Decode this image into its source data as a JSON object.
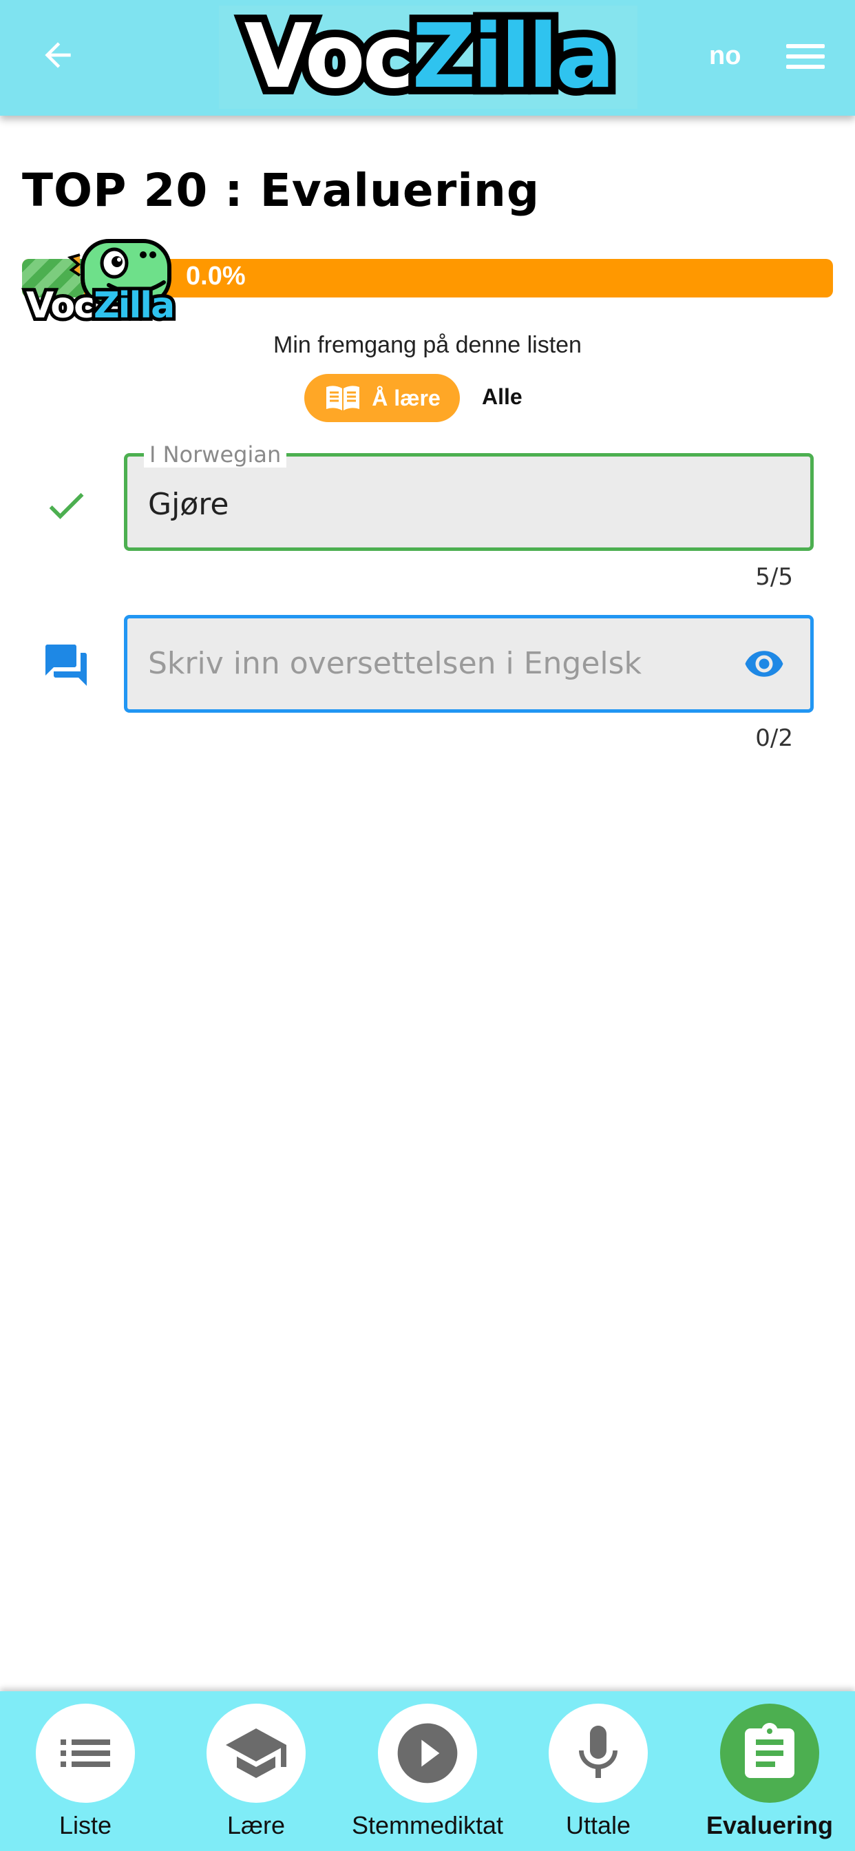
{
  "header": {
    "logo_part1": "Voc",
    "logo_part2": "Zilla",
    "language": "no",
    "back_icon": "arrow-left-icon",
    "menu_icon": "hamburger-menu-icon"
  },
  "page": {
    "title": "TOP 20 : Evaluering"
  },
  "progress": {
    "percent": 0.0,
    "text": "0.0%",
    "logo_part1": "Voc",
    "logo_part2": "Zilla",
    "caption": "Min fremgang på denne listen"
  },
  "toggle": {
    "learn_label": "Å lære",
    "all_label": "Alle",
    "learn_icon": "open-book-icon"
  },
  "norwegian_field": {
    "label": "I Norwegian",
    "value": "Gjøre",
    "counter": "5/5",
    "status_icon": "check-icon"
  },
  "english_field": {
    "placeholder": "Skriv inn oversettelsen i Engelsk",
    "value": "",
    "counter": "0/2",
    "icon": "chat-icon",
    "reveal_icon": "eye-icon"
  },
  "bottom_nav": {
    "items": [
      {
        "label": "Liste",
        "icon": "list-icon"
      },
      {
        "label": "Lære",
        "icon": "graduation-cap-icon"
      },
      {
        "label": "Stemmediktat",
        "icon": "play-icon"
      },
      {
        "label": "Uttale",
        "icon": "microphone-icon"
      },
      {
        "label": "Evaluering",
        "icon": "clipboard-icon",
        "active": true
      }
    ]
  },
  "colors": {
    "header_bg": "#7fe3f0",
    "progress_bar": "#ff9800",
    "progress_fill": "#4caf50",
    "toggle_active": "#ffa726",
    "success_border": "#4caf50",
    "focus_border": "#2196f3",
    "nav_bg": "#7fecf7",
    "nav_active": "#4caf50"
  }
}
